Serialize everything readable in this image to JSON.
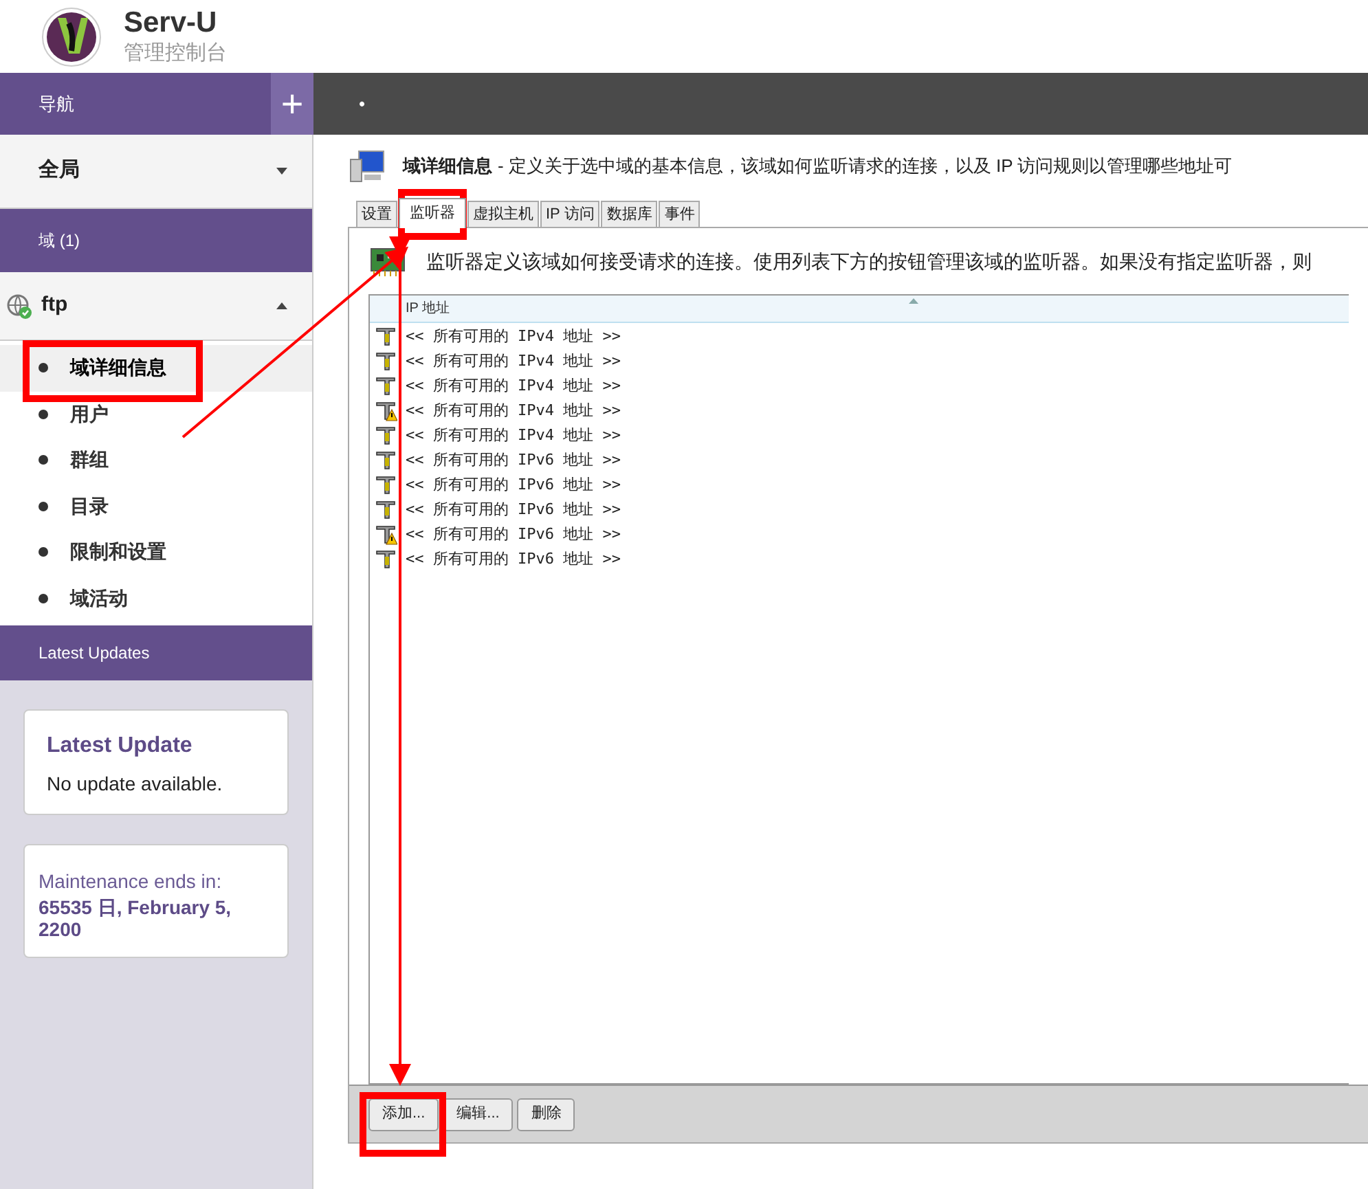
{
  "header": {
    "title": "Serv-U",
    "subtitle": "管理控制台"
  },
  "nav": {
    "title": "导航",
    "add_button": "+",
    "top_bar_mark": "•"
  },
  "sidebar": {
    "global": {
      "label": "全局",
      "expanded": false
    },
    "domains_header": "域 (1)",
    "domain": {
      "name": "ftp",
      "expanded": true
    },
    "items": [
      {
        "label": "域详细信息",
        "selected": true
      },
      {
        "label": "用户",
        "selected": false
      },
      {
        "label": "群组",
        "selected": false
      },
      {
        "label": "目录",
        "selected": false
      },
      {
        "label": "限制和设置",
        "selected": false
      },
      {
        "label": "域活动",
        "selected": false
      }
    ],
    "updates_header": "Latest Updates",
    "update_card": {
      "title": "Latest Update",
      "text": "No update available."
    },
    "maintenance_card": {
      "label": "Maintenance ends in:",
      "value": "65535 日, February 5, 2200"
    }
  },
  "page": {
    "title": "域详细信息",
    "description": "- 定义关于选中域的基本信息，该域如何监听请求的连接，以及 IP 访问规则以管理哪些地址可",
    "tabs": [
      {
        "label": "设置",
        "selected": false
      },
      {
        "label": "监听器",
        "selected": true
      },
      {
        "label": "虚拟主机",
        "selected": false
      },
      {
        "label": "IP 访问",
        "selected": false
      },
      {
        "label": "数据库",
        "selected": false
      },
      {
        "label": "事件",
        "selected": false
      }
    ],
    "panel_text": "监听器定义该域如何接受请求的连接。使用列表下方的按钮管理该域的监听器。如果没有指定监听器，则",
    "table": {
      "columns": [
        "IP 地址"
      ],
      "rows": [
        {
          "kind": "normal",
          "address": "<< 所有可用的 IPv4 地址 >>"
        },
        {
          "kind": "normal",
          "address": "<< 所有可用的 IPv4 地址 >>"
        },
        {
          "kind": "normal",
          "address": "<< 所有可用的 IPv4 地址 >>"
        },
        {
          "kind": "warning",
          "address": "<< 所有可用的 IPv4 地址 >>"
        },
        {
          "kind": "normal",
          "address": "<< 所有可用的 IPv4 地址 >>"
        },
        {
          "kind": "normal",
          "address": "<< 所有可用的 IPv6 地址 >>"
        },
        {
          "kind": "normal",
          "address": "<< 所有可用的 IPv6 地址 >>"
        },
        {
          "kind": "normal",
          "address": "<< 所有可用的 IPv6 地址 >>"
        },
        {
          "kind": "warning",
          "address": "<< 所有可用的 IPv6 地址 >>"
        },
        {
          "kind": "normal",
          "address": "<< 所有可用的 IPv6 地址 >>"
        }
      ]
    },
    "buttons": [
      "添加...",
      "编辑...",
      "删除"
    ]
  }
}
